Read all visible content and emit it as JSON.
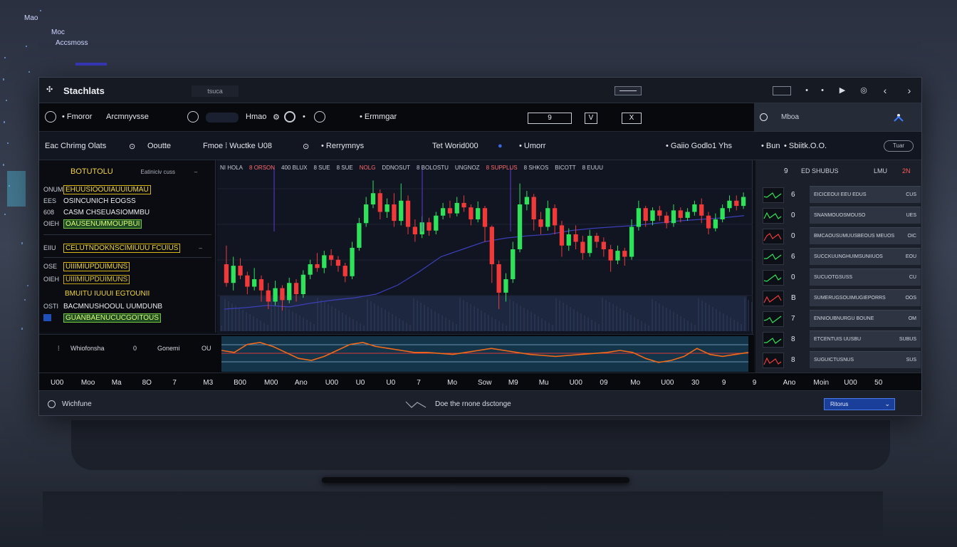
{
  "background_labels": [
    "Mao",
    "Mao",
    "Moc",
    "Moc",
    "Accsmoss"
  ],
  "window": {
    "title": "Stachlats",
    "title_sub": "tsuca",
    "title_controls": [
      "•",
      "•",
      "▶",
      "◎",
      "‹",
      "›"
    ]
  },
  "toolbar": {
    "items": [
      "Fmoror",
      "Arcmnyvsse",
      "Hmao",
      "Ermmgar"
    ],
    "box_a": "9",
    "box_b": "V",
    "box_c": "X"
  },
  "side_header": {
    "label": "Mboa"
  },
  "subbar": {
    "items": [
      "Eac",
      "Chrimg",
      "Olats",
      "Ooutte",
      "Fmoe",
      "Wuctke",
      "U08",
      "Rerrymnys",
      "Tet Worid000",
      "Umorr",
      "Gaiio",
      "Godlo1",
      "Yhs",
      "Bun",
      "Sbiitk.O.O."
    ],
    "pill": "Tuar"
  },
  "left_panel": {
    "title": "BOTUTOLU",
    "title_right": "Eatiniciv cuss",
    "rows": [
      {
        "code": "",
        "text": "EHUUSIOOUIAUUIUMAU",
        "style": "y"
      },
      {
        "code": "EES",
        "text": "OSINCUNICH EOGSS",
        "style": ""
      },
      {
        "code": "608",
        "text": "CASM CHSEUASIOMMBU",
        "style": ""
      },
      {
        "code": "",
        "text": "OAUSENUMMOUPBUI",
        "style": "g"
      },
      {
        "code": "EIIU",
        "text": "CELUTNDOKNSCIMIUUU FCUIUS",
        "style": "y"
      },
      {
        "code": "",
        "text": "UIIIMIUPDUIMUNS",
        "style": "y"
      },
      {
        "code": "",
        "text": "BMUITU IUUUI EGTOUNII",
        "style": "y"
      },
      {
        "code": "OSTI",
        "text": "BACMNUSHOOUL UUMDUNB",
        "style": ""
      },
      {
        "code": "",
        "text": "GUANBAENUCUCGOITOUS",
        "style": "g"
      }
    ],
    "codes_left": [
      "ONUM",
      "EES",
      "OIEH",
      "608",
      "OIEH",
      "OSE",
      "OSTI"
    ]
  },
  "chart": {
    "header": [
      "NI HOLA",
      "8 ORSON",
      "400 BLUX",
      "8 SUE",
      "8 SUE",
      "NOLG",
      "DDNOSUT",
      "8 BOLOSTU",
      "UNGNOZ",
      "8 SUPPLUS",
      "8 SHKOS",
      "BICOTT",
      "8 EUUU"
    ],
    "indicator_labels": [
      "8",
      "Whiofonsha",
      "0",
      "Gonemi",
      "OU"
    ]
  },
  "chart_data": {
    "type": "candlestick",
    "candles": [
      {
        "o": 120,
        "c": 95,
        "h": 145,
        "l": 90
      },
      {
        "o": 95,
        "c": 118,
        "h": 130,
        "l": 85
      },
      {
        "o": 118,
        "c": 105,
        "h": 128,
        "l": 100
      },
      {
        "o": 105,
        "c": 90,
        "h": 110,
        "l": 80
      },
      {
        "o": 90,
        "c": 100,
        "h": 115,
        "l": 85
      },
      {
        "o": 100,
        "c": 85,
        "h": 105,
        "l": 70
      },
      {
        "o": 85,
        "c": 70,
        "h": 95,
        "l": 60
      },
      {
        "o": 70,
        "c": 88,
        "h": 98,
        "l": 65
      },
      {
        "o": 88,
        "c": 72,
        "h": 92,
        "l": 58
      },
      {
        "o": 72,
        "c": 95,
        "h": 102,
        "l": 68
      },
      {
        "o": 95,
        "c": 80,
        "h": 100,
        "l": 70
      },
      {
        "o": 80,
        "c": 106,
        "h": 112,
        "l": 75
      },
      {
        "o": 106,
        "c": 120,
        "h": 126,
        "l": 100
      },
      {
        "o": 120,
        "c": 115,
        "h": 135,
        "l": 110
      },
      {
        "o": 115,
        "c": 132,
        "h": 138,
        "l": 108
      },
      {
        "o": 132,
        "c": 126,
        "h": 140,
        "l": 118
      },
      {
        "o": 126,
        "c": 118,
        "h": 131,
        "l": 110
      },
      {
        "o": 118,
        "c": 104,
        "h": 122,
        "l": 96
      },
      {
        "o": 104,
        "c": 142,
        "h": 150,
        "l": 100
      },
      {
        "o": 142,
        "c": 175,
        "h": 182,
        "l": 138
      },
      {
        "o": 175,
        "c": 200,
        "h": 210,
        "l": 170
      },
      {
        "o": 200,
        "c": 215,
        "h": 232,
        "l": 195
      },
      {
        "o": 215,
        "c": 190,
        "h": 220,
        "l": 180
      },
      {
        "o": 190,
        "c": 200,
        "h": 208,
        "l": 182
      },
      {
        "o": 200,
        "c": 178,
        "h": 215,
        "l": 170
      },
      {
        "o": 178,
        "c": 205,
        "h": 228,
        "l": 172
      },
      {
        "o": 205,
        "c": 170,
        "h": 212,
        "l": 160
      },
      {
        "o": 170,
        "c": 160,
        "h": 180,
        "l": 150
      },
      {
        "o": 160,
        "c": 176,
        "h": 184,
        "l": 155
      },
      {
        "o": 176,
        "c": 165,
        "h": 182,
        "l": 158
      },
      {
        "o": 165,
        "c": 185,
        "h": 190,
        "l": 160
      },
      {
        "o": 185,
        "c": 195,
        "h": 202,
        "l": 180
      },
      {
        "o": 195,
        "c": 188,
        "h": 205,
        "l": 182
      },
      {
        "o": 188,
        "c": 202,
        "h": 210,
        "l": 184
      },
      {
        "o": 202,
        "c": 196,
        "h": 212,
        "l": 190
      },
      {
        "o": 196,
        "c": 180,
        "h": 200,
        "l": 172
      },
      {
        "o": 180,
        "c": 195,
        "h": 204,
        "l": 176
      },
      {
        "o": 195,
        "c": 170,
        "h": 198,
        "l": 150
      },
      {
        "o": 170,
        "c": 120,
        "h": 172,
        "l": 95
      },
      {
        "o": 120,
        "c": 82,
        "h": 125,
        "l": 60
      },
      {
        "o": 82,
        "c": 100,
        "h": 108,
        "l": 70
      },
      {
        "o": 100,
        "c": 140,
        "h": 150,
        "l": 95
      },
      {
        "o": 140,
        "c": 200,
        "h": 228,
        "l": 136
      },
      {
        "o": 200,
        "c": 210,
        "h": 218,
        "l": 192
      },
      {
        "o": 210,
        "c": 180,
        "h": 214,
        "l": 165
      },
      {
        "o": 180,
        "c": 170,
        "h": 190,
        "l": 160
      },
      {
        "o": 170,
        "c": 195,
        "h": 205,
        "l": 165
      },
      {
        "o": 195,
        "c": 172,
        "h": 200,
        "l": 160
      },
      {
        "o": 172,
        "c": 145,
        "h": 178,
        "l": 130
      },
      {
        "o": 145,
        "c": 160,
        "h": 168,
        "l": 138
      },
      {
        "o": 160,
        "c": 150,
        "h": 172,
        "l": 140
      },
      {
        "o": 150,
        "c": 135,
        "h": 158,
        "l": 126
      },
      {
        "o": 135,
        "c": 158,
        "h": 166,
        "l": 130
      },
      {
        "o": 158,
        "c": 150,
        "h": 162,
        "l": 142
      },
      {
        "o": 150,
        "c": 140,
        "h": 156,
        "l": 130
      },
      {
        "o": 140,
        "c": 125,
        "h": 146,
        "l": 110
      },
      {
        "o": 125,
        "c": 138,
        "h": 145,
        "l": 120
      },
      {
        "o": 138,
        "c": 130,
        "h": 142,
        "l": 118
      },
      {
        "o": 130,
        "c": 170,
        "h": 180,
        "l": 126
      },
      {
        "o": 170,
        "c": 195,
        "h": 205,
        "l": 165
      },
      {
        "o": 195,
        "c": 178,
        "h": 198,
        "l": 170
      },
      {
        "o": 178,
        "c": 192,
        "h": 196,
        "l": 172
      },
      {
        "o": 192,
        "c": 185,
        "h": 198,
        "l": 178
      },
      {
        "o": 185,
        "c": 175,
        "h": 190,
        "l": 168
      },
      {
        "o": 175,
        "c": 192,
        "h": 200,
        "l": 170
      },
      {
        "o": 192,
        "c": 182,
        "h": 196,
        "l": 176
      },
      {
        "o": 182,
        "c": 190,
        "h": 195,
        "l": 178
      },
      {
        "o": 190,
        "c": 200,
        "h": 205,
        "l": 185
      },
      {
        "o": 200,
        "c": 185,
        "h": 208,
        "l": 175
      },
      {
        "o": 185,
        "c": 168,
        "h": 190,
        "l": 160
      },
      {
        "o": 168,
        "c": 180,
        "h": 188,
        "l": 164
      },
      {
        "o": 180,
        "c": 195,
        "h": 200,
        "l": 176
      },
      {
        "o": 195,
        "c": 205,
        "h": 212,
        "l": 190
      },
      {
        "o": 205,
        "c": 198,
        "h": 212,
        "l": 192
      },
      {
        "o": 198,
        "c": 210,
        "h": 216,
        "l": 194
      }
    ],
    "ma_line": [
      60,
      62,
      65,
      63,
      68,
      72,
      75,
      80,
      92,
      110,
      130,
      140,
      150,
      155,
      158,
      160,
      165,
      168,
      170,
      172,
      175,
      178,
      180,
      182,
      185
    ],
    "indicator": [
      20,
      18,
      26,
      28,
      24,
      18,
      12,
      10,
      14,
      20,
      26,
      28,
      24,
      22,
      20,
      18,
      18,
      17,
      16,
      18,
      20,
      22,
      20,
      18,
      16,
      15,
      14,
      15,
      16,
      17,
      18,
      20,
      18,
      12,
      8,
      10,
      14,
      22,
      16,
      14,
      16,
      18
    ]
  },
  "right_panel": {
    "header_a": "9",
    "header_b": "ED SHUBUS",
    "header_c": "LMU",
    "header_d": "2N",
    "rows": [
      {
        "sym": "6",
        "text": "EICICEOUI EEU EDUS",
        "val": "CUS"
      },
      {
        "sym": "0",
        "text": "SNANMOUOSMOUSO",
        "val": "UES"
      },
      {
        "sym": "0",
        "text": "BMCAOUSUMUUSBEOUS MEUOS",
        "val": "OIC"
      },
      {
        "sym": "6",
        "text": "SUCCKUUNGHUIMSUNIIUOS",
        "val": "EOU"
      },
      {
        "sym": "0",
        "text": "SUCUOTGSUSS",
        "val": "CU"
      },
      {
        "sym": "B",
        "text": "SUMERUGSOUIMUGIEPORRS",
        "val": "OOS"
      },
      {
        "sym": "7",
        "text": "ENNIOUBNURGU BOUNE",
        "val": "OM"
      },
      {
        "sym": "8",
        "text": "ETCENTUIS UUSBU",
        "val": "SUBUS"
      },
      {
        "sym": "8",
        "text": "SUGUICTUSNUS",
        "val": "SUS"
      }
    ]
  },
  "timeline": {
    "ticks": [
      "U00",
      "Moo",
      "Ma",
      "8O",
      "7",
      "M3",
      "B00",
      "M00",
      "Ano",
      "U00",
      "U0",
      "U0",
      "7",
      "Mo",
      "Sow",
      "M9",
      "Mu",
      "U00",
      "09",
      "Mo",
      "U00",
      "30",
      "9",
      "9",
      "Ano",
      "Moin",
      "U00",
      "50"
    ]
  },
  "status": {
    "left_label": "Wichfune",
    "center_label": "Doe the rnone dsctonge",
    "select_value": "Ritorus"
  },
  "colors": {
    "up": "#2ee35a",
    "down": "#f03a3a",
    "accent": "#1f4fb8",
    "indicator_line": "#f06a1a"
  }
}
